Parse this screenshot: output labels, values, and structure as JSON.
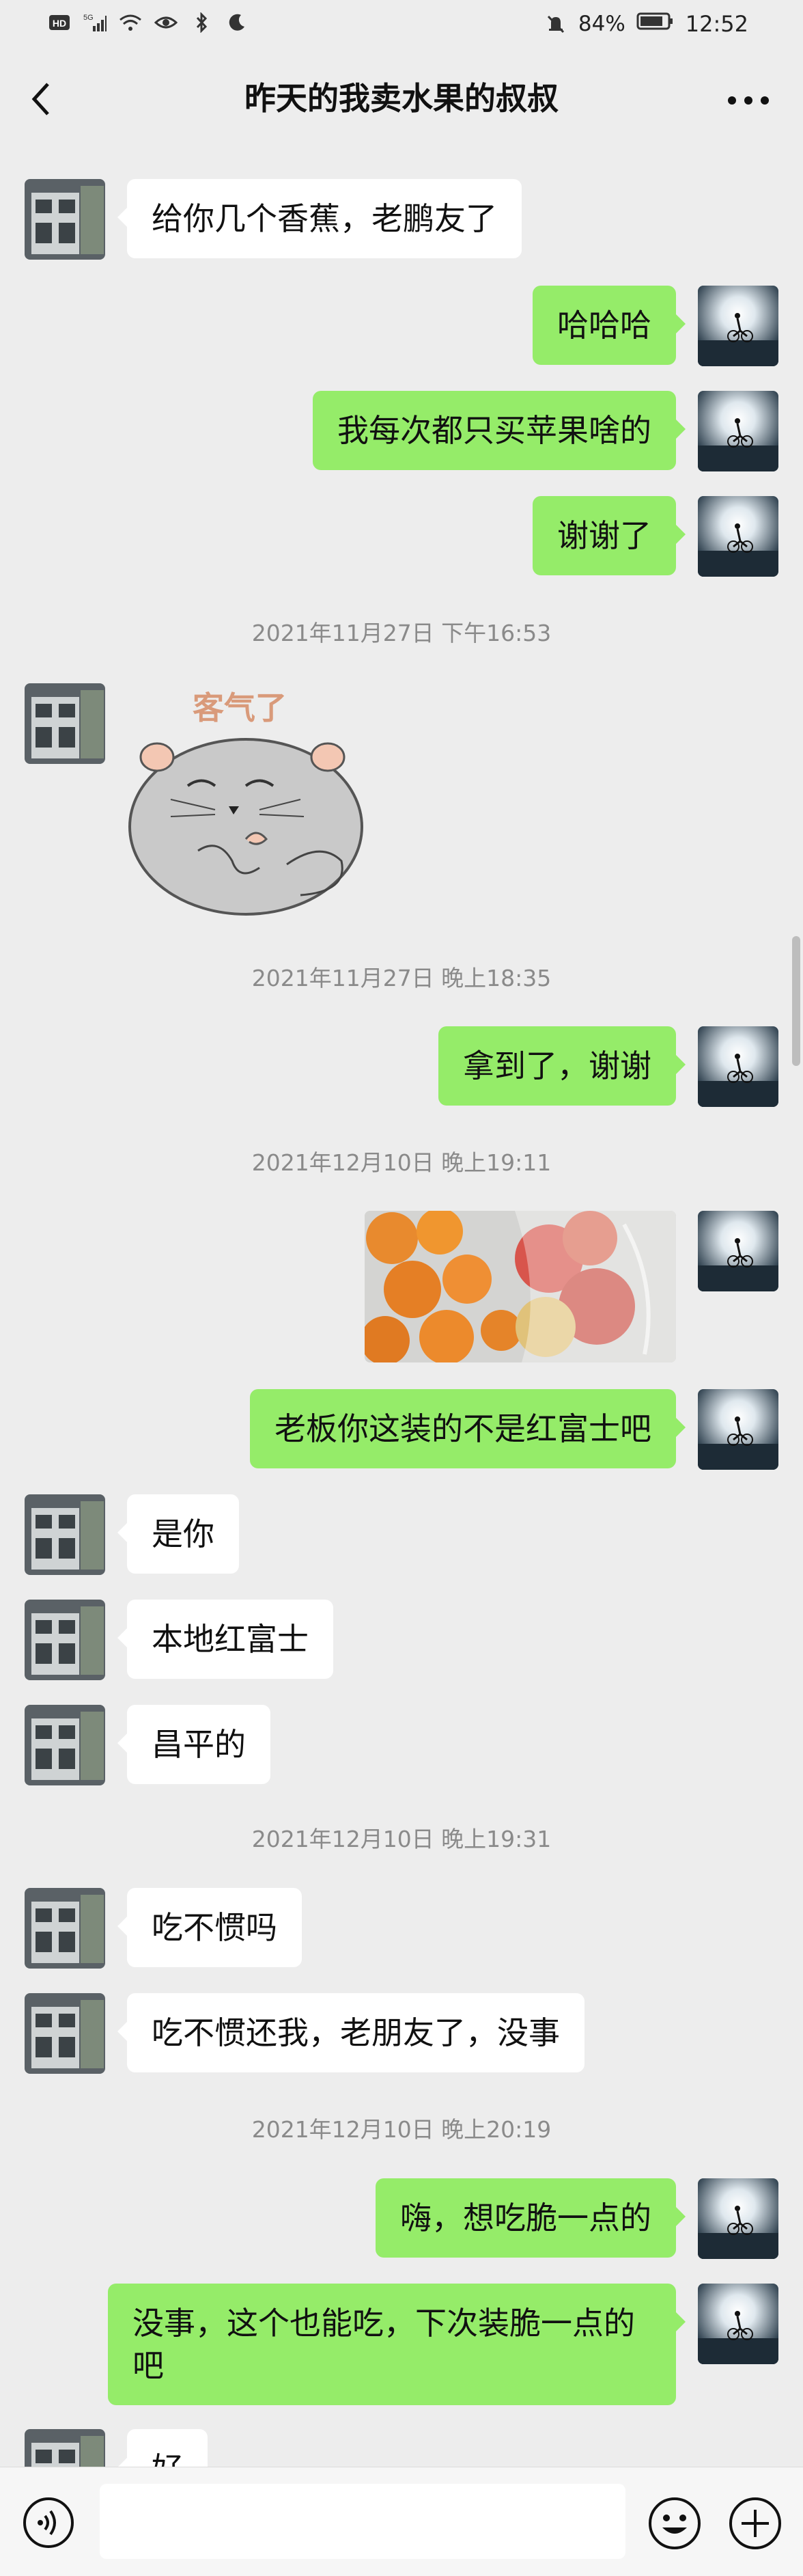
{
  "status": {
    "left_icons": [
      "hd-icon",
      "5g-signal-icon",
      "wifi-icon",
      "eye-icon",
      "bluetooth-icon",
      "moon-icon"
    ],
    "battery": "84%",
    "time": "12:52"
  },
  "header": {
    "title": "昨天的我卖水果的叔叔"
  },
  "messages": {
    "m1": "给你几个香蕉，老鹏友了",
    "m2": "哈哈哈",
    "m3": "我每次都只买苹果啥的",
    "m4": "谢谢了",
    "t1": "2021年11月27日 下午16:53",
    "sticker_caption": "客气了",
    "t2": "2021年11月27日 晚上18:35",
    "m5": "拿到了，谢谢",
    "t3": "2021年12月10日 晚上19:11",
    "m6": "老板你这装的不是红富士吧",
    "m7": "是你",
    "m8": "本地红富士",
    "m9": "昌平的",
    "t4": "2021年12月10日 晚上19:31",
    "m10": "吃不惯吗",
    "m11": "吃不惯还我，老朋友了，没事",
    "t5": "2021年12月10日 晚上20:19",
    "m12": "嗨，想吃脆一点的",
    "m13": "没事，这个也能吃，下次装脆一点的吧",
    "m14": "好"
  },
  "colors": {
    "outgoing": "#95ec69",
    "incoming": "#ffffff",
    "background": "#ededed"
  }
}
